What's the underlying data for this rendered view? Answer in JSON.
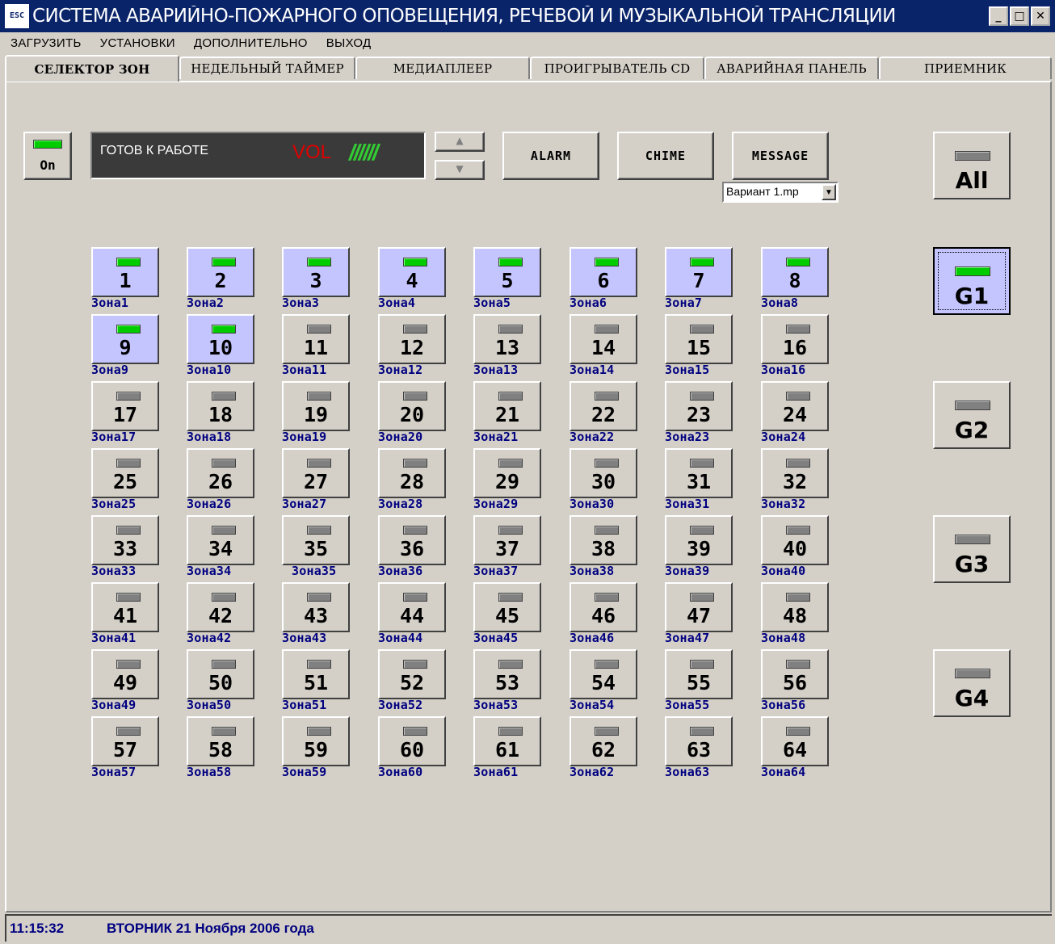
{
  "window": {
    "title": "СИСТЕМА АВАРИЙНО-ПОЖАРНОГО ОПОВЕЩЕНИЯ, РЕЧЕВОЙ И МУЗЫКАЛЬНОЙ ТРАНСЛЯЦИИ",
    "icon_text": "ESC",
    "minimize": "_",
    "maximize": "□",
    "close": "✕"
  },
  "menu": [
    "ЗАГРУЗИТЬ",
    "УСТАНОВКИ",
    "ДОПОЛНИТЕЛЬНО",
    "ВЫХОД"
  ],
  "tabs": [
    {
      "label": "СЕЛЕКТОР ЗОН",
      "active": true
    },
    {
      "label": "НЕДЕЛЬНЫЙ ТАЙМЕР",
      "active": false
    },
    {
      "label": "МЕДИАПЛЕЕР",
      "active": false
    },
    {
      "label": "ПРОИГРЫВАТЕЛЬ CD",
      "active": false
    },
    {
      "label": "АВАРИЙНАЯ ПАНЕЛЬ",
      "active": false
    },
    {
      "label": "ПРИЕМНИК",
      "active": false
    }
  ],
  "power": {
    "label": "On",
    "led": "on"
  },
  "display": {
    "status": "ГОТОВ К РАБОТЕ",
    "vol_label": "VOL",
    "vol_bars": "//////",
    "vol_color": "#e00000",
    "bars_color": "#33cc33"
  },
  "volume_up": "▲",
  "volume_down": "▼",
  "actions": {
    "alarm": "ALARM",
    "chime": "CHIME",
    "message": "MESSAGE"
  },
  "message_select": {
    "value": "Вариант 1.mp",
    "arrow": "▼"
  },
  "groups": [
    {
      "label": "All",
      "led": "off",
      "selected": false
    },
    {
      "label": "G1",
      "led": "on",
      "selected": true
    },
    {
      "label": "G2",
      "led": "off",
      "selected": false
    },
    {
      "label": "G3",
      "led": "off",
      "selected": false
    },
    {
      "label": "G4",
      "led": "off",
      "selected": false
    }
  ],
  "zones": [
    {
      "num": "1",
      "label": "Зона1",
      "on": true
    },
    {
      "num": "2",
      "label": "Зона2",
      "on": true
    },
    {
      "num": "3",
      "label": "Зона3",
      "on": true
    },
    {
      "num": "4",
      "label": "Зона4",
      "on": true
    },
    {
      "num": "5",
      "label": "Зона5",
      "on": true
    },
    {
      "num": "6",
      "label": "Зона6",
      "on": true
    },
    {
      "num": "7",
      "label": "Зона7",
      "on": true
    },
    {
      "num": "8",
      "label": "Зона8",
      "on": true
    },
    {
      "num": "9",
      "label": "Зона9",
      "on": true
    },
    {
      "num": "10",
      "label": "Зона10",
      "on": true
    },
    {
      "num": "11",
      "label": "Зона11",
      "on": false
    },
    {
      "num": "12",
      "label": "Зона12",
      "on": false
    },
    {
      "num": "13",
      "label": "Зона13",
      "on": false
    },
    {
      "num": "14",
      "label": "Зона14",
      "on": false
    },
    {
      "num": "15",
      "label": "Зона15",
      "on": false
    },
    {
      "num": "16",
      "label": "Зона16",
      "on": false
    },
    {
      "num": "17",
      "label": "Зона17",
      "on": false
    },
    {
      "num": "18",
      "label": "Зона18",
      "on": false
    },
    {
      "num": "19",
      "label": "Зона19",
      "on": false
    },
    {
      "num": "20",
      "label": "Зона20",
      "on": false
    },
    {
      "num": "21",
      "label": "Зона21",
      "on": false
    },
    {
      "num": "22",
      "label": "Зона22",
      "on": false
    },
    {
      "num": "23",
      "label": "Зона23",
      "on": false
    },
    {
      "num": "24",
      "label": "Зона24",
      "on": false
    },
    {
      "num": "25",
      "label": "Зона25",
      "on": false
    },
    {
      "num": "26",
      "label": "Зона26",
      "on": false
    },
    {
      "num": "27",
      "label": "Зона27",
      "on": false
    },
    {
      "num": "28",
      "label": "Зона28",
      "on": false
    },
    {
      "num": "29",
      "label": "Зона29",
      "on": false
    },
    {
      "num": "30",
      "label": "Зона30",
      "on": false
    },
    {
      "num": "31",
      "label": "Зона31",
      "on": false
    },
    {
      "num": "32",
      "label": "Зона32",
      "on": false
    },
    {
      "num": "33",
      "label": "Зона33",
      "on": false
    },
    {
      "num": "34",
      "label": "Зона34",
      "on": false
    },
    {
      "num": "35",
      "label": "Зона35",
      "on": false
    },
    {
      "num": "36",
      "label": "Зона36",
      "on": false
    },
    {
      "num": "37",
      "label": "Зона37",
      "on": false
    },
    {
      "num": "38",
      "label": "Зона38",
      "on": false
    },
    {
      "num": "39",
      "label": "Зона39",
      "on": false
    },
    {
      "num": "40",
      "label": "Зона40",
      "on": false
    },
    {
      "num": "41",
      "label": "Зона41",
      "on": false
    },
    {
      "num": "42",
      "label": "Зона42",
      "on": false
    },
    {
      "num": "43",
      "label": "Зона43",
      "on": false
    },
    {
      "num": "44",
      "label": "Зона44",
      "on": false
    },
    {
      "num": "45",
      "label": "Зона45",
      "on": false
    },
    {
      "num": "46",
      "label": "Зона46",
      "on": false
    },
    {
      "num": "47",
      "label": "Зона47",
      "on": false
    },
    {
      "num": "48",
      "label": "Зона48",
      "on": false
    },
    {
      "num": "49",
      "label": "Зона49",
      "on": false
    },
    {
      "num": "50",
      "label": "Зона50",
      "on": false
    },
    {
      "num": "51",
      "label": "Зона51",
      "on": false
    },
    {
      "num": "52",
      "label": "Зона52",
      "on": false
    },
    {
      "num": "53",
      "label": "Зона53",
      "on": false
    },
    {
      "num": "54",
      "label": "Зона54",
      "on": false
    },
    {
      "num": "55",
      "label": "Зона55",
      "on": false
    },
    {
      "num": "56",
      "label": "Зона56",
      "on": false
    },
    {
      "num": "57",
      "label": "Зона57",
      "on": false
    },
    {
      "num": "58",
      "label": "Зона58",
      "on": false
    },
    {
      "num": "59",
      "label": "Зона59",
      "on": false
    },
    {
      "num": "60",
      "label": "Зона60",
      "on": false
    },
    {
      "num": "61",
      "label": "Зона61",
      "on": false
    },
    {
      "num": "62",
      "label": "Зона62",
      "on": false
    },
    {
      "num": "63",
      "label": "Зона63",
      "on": false
    },
    {
      "num": "64",
      "label": "Зона64",
      "on": false
    }
  ],
  "status": {
    "time": "11:15:32",
    "date": "ВТОРНИК 21 Ноября 2006 года"
  },
  "colors": {
    "title_bar": "#0a246a",
    "face": "#d4d0c8",
    "zone_active": "#c4c4ff",
    "led_on": "#00cc00",
    "led_off": "#808080",
    "zone_label": "#000080"
  }
}
